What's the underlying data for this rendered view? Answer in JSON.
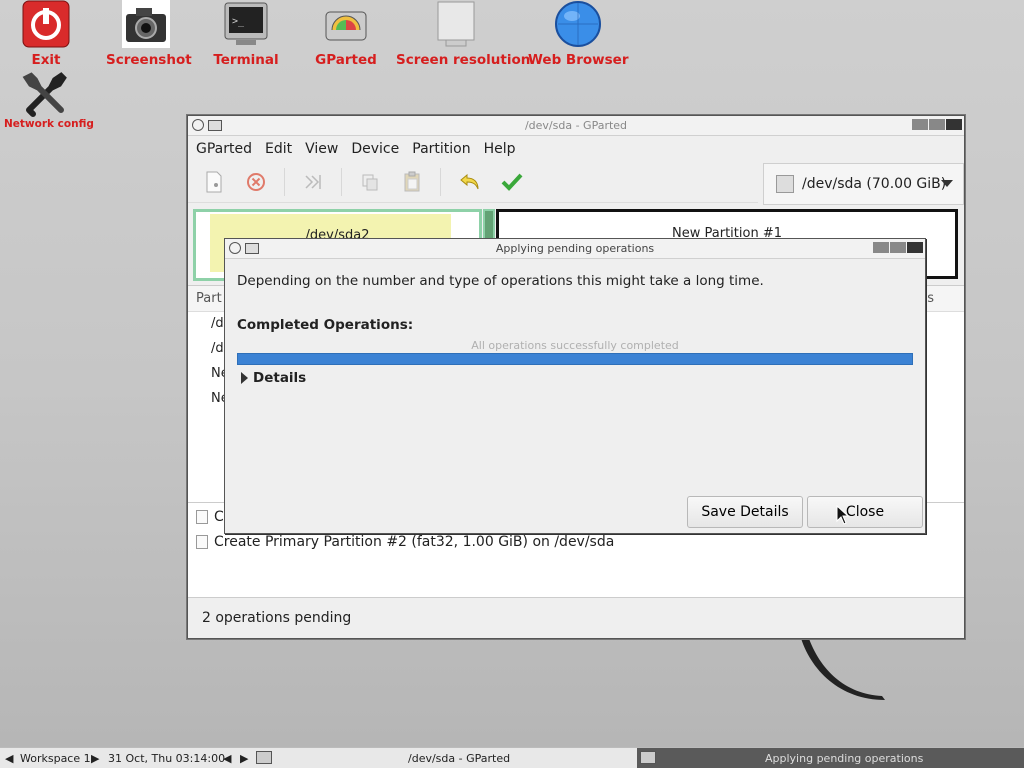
{
  "desktop": {
    "icons": [
      {
        "label": "Exit"
      },
      {
        "label": "Screenshot"
      },
      {
        "label": "Terminal"
      },
      {
        "label": "GParted"
      },
      {
        "label": "Screen resolution"
      },
      {
        "label": "Web Browser"
      },
      {
        "label": "Network config"
      }
    ]
  },
  "main_window": {
    "title": "/dev/sda - GParted",
    "menu": [
      "GParted",
      "Edit",
      "View",
      "Device",
      "Partition",
      "Help"
    ],
    "device_selector": "/dev/sda (70.00 GiB)",
    "partitions": {
      "p1_label": "/dev/sda2",
      "p2_label": "New Partition #1"
    },
    "list_header_left": "Part",
    "list_header_right": "s",
    "rows": [
      "/d",
      "/d",
      "Ne",
      "Ne"
    ],
    "operations": [
      "Cr",
      "Create Primary Partition #2 (fat32, 1.00 GiB) on /dev/sda"
    ],
    "status": "2 operations pending"
  },
  "dialog": {
    "title": "Applying pending operations",
    "description": "Depending on the number and type of operations this might take a long time.",
    "completed_label": "Completed Operations:",
    "progress_text": "All operations successfully completed",
    "progress": 1.0,
    "details_label": "Details",
    "save_button": "Save Details",
    "close_button": "Close"
  },
  "taskbar": {
    "workspace": "Workspace 1",
    "datetime": "31 Oct, Thu 03:14:00",
    "task1": "/dev/sda - GParted",
    "task2": "Applying pending operations"
  },
  "colors": {
    "icon_label": "#d61e1e",
    "progress": "#3b82d4",
    "partition_border_green": "#8ed1a8",
    "partition_fill_yellow": "#f3f3b0"
  }
}
